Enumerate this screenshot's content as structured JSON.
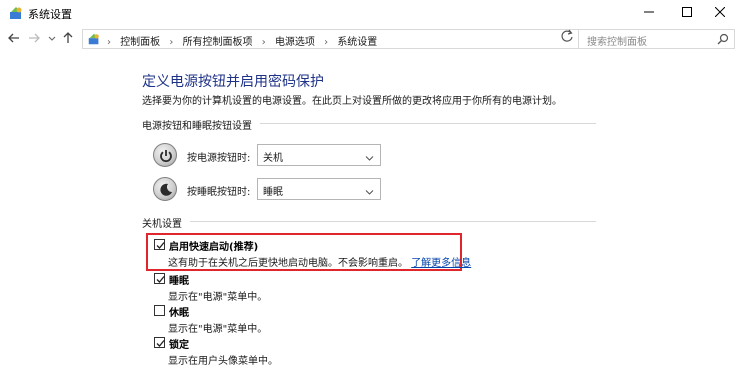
{
  "window": {
    "title": "系统设置"
  },
  "nav": {
    "breadcrumbs": [
      "控制面板",
      "所有控制面板项",
      "电源选项",
      "系统设置"
    ],
    "search_placeholder": "搜索控制面板"
  },
  "page": {
    "title": "定义电源按钮并启用密码保护",
    "description": "选择要为你的计算机设置的电源设置。在此页上对设置所做的更改将应用于你所有的电源计划。"
  },
  "power_buttons": {
    "heading": "电源按钮和睡眠按钮设置",
    "power": {
      "label": "按电源按钮时:",
      "value": "关机",
      "icon": "power-icon"
    },
    "sleep": {
      "label": "按睡眠按钮时:",
      "value": "睡眠",
      "icon": "moon-icon"
    }
  },
  "shutdown": {
    "heading": "关机设置",
    "items": [
      {
        "label": "启用快速启动(推荐)",
        "checked": true,
        "description": "这有助于在关机之后更快地启动电脑。不会影响重启。",
        "link": "了解更多信息"
      },
      {
        "label": "睡眠",
        "checked": true,
        "description": "显示在\"电源\"菜单中。"
      },
      {
        "label": "休眠",
        "checked": false,
        "description": "显示在\"电源\"菜单中。"
      },
      {
        "label": "锁定",
        "checked": true,
        "description": "显示在用户头像菜单中。"
      }
    ]
  },
  "colors": {
    "title_blue": "#1e3287",
    "link_blue": "#0645ad",
    "highlight_red": "#e0262b"
  }
}
